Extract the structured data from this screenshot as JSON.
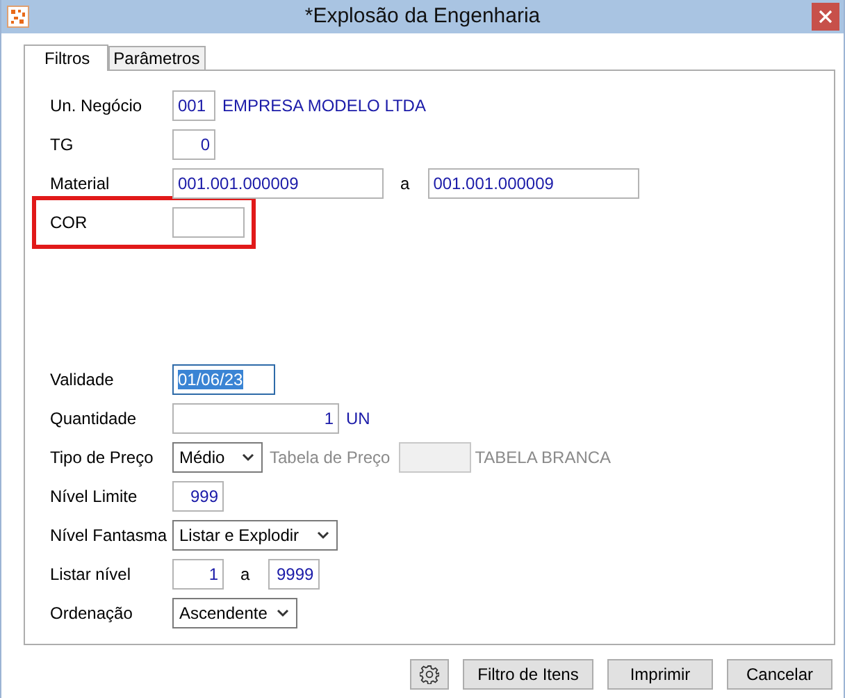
{
  "window": {
    "title": "*Explosão da Engenharia"
  },
  "tabs": [
    {
      "label": "Filtros",
      "selected": true
    },
    {
      "label": "Parâmetros",
      "selected": false
    }
  ],
  "field_groups": [
    [
      {
        "label": "Un. Negócio",
        "highlighted": false,
        "items": [
          {
            "kind": "field",
            "value": "001"
          },
          {
            "kind": "text",
            "text": "EMPRESA MODELO LTDA",
            "disabled": false
          }
        ]
      },
      {
        "label": "TG",
        "highlighted": false,
        "items": [
          {
            "kind": "numeric",
            "value": "0"
          }
        ]
      },
      {
        "label": "Material",
        "highlighted": false,
        "items": [
          {
            "kind": "field",
            "value": "001.001.000009"
          },
          {
            "kind": "sep",
            "text": "a"
          },
          {
            "kind": "field",
            "value": "001.001.000009"
          }
        ]
      },
      {
        "label": "COR",
        "highlighted": true,
        "items": [
          {
            "kind": "field"
          }
        ]
      }
    ],
    [
      {
        "label": "Validade",
        "highlighted": false,
        "items": [
          {
            "kind": "field",
            "value": "01/06/23",
            "focused": true
          }
        ]
      },
      {
        "label": "Quantidade",
        "highlighted": false,
        "items": [
          {
            "kind": "numeric",
            "value": "1"
          },
          {
            "kind": "text",
            "text": "UN",
            "disabled": false
          }
        ]
      },
      {
        "label": "Tipo de Preço",
        "highlighted": false,
        "items": [
          {
            "kind": "select",
            "value": "Médio"
          },
          {
            "kind": "text",
            "text": "Tabela de Preço",
            "disabled": true
          },
          {
            "kind": "field",
            "disabled": true
          },
          {
            "kind": "text",
            "text": "TABELA BRANCA",
            "disabled": true
          }
        ]
      },
      {
        "label": "Nível Limite",
        "highlighted": false,
        "items": [
          {
            "kind": "numeric",
            "value": "999"
          }
        ]
      },
      {
        "label": "Nível Fantasma",
        "highlighted": false,
        "items": [
          {
            "kind": "select",
            "value": "Listar e Explodir"
          }
        ]
      },
      {
        "label": "Listar nível",
        "highlighted": false,
        "items": [
          {
            "kind": "numeric",
            "value": "1"
          },
          {
            "kind": "sep",
            "text": "a"
          },
          {
            "kind": "numeric",
            "value": "9999"
          }
        ]
      },
      {
        "label": "Ordenação",
        "highlighted": false,
        "items": [
          {
            "kind": "select",
            "value": "Ascendente"
          }
        ]
      }
    ]
  ],
  "buttons": [
    {
      "kind": "settings"
    },
    {
      "kind": "text",
      "label": "Filtro de Itens"
    },
    {
      "kind": "text",
      "label": "Imprimir"
    },
    {
      "kind": "text",
      "label": "Cancelar"
    }
  ]
}
